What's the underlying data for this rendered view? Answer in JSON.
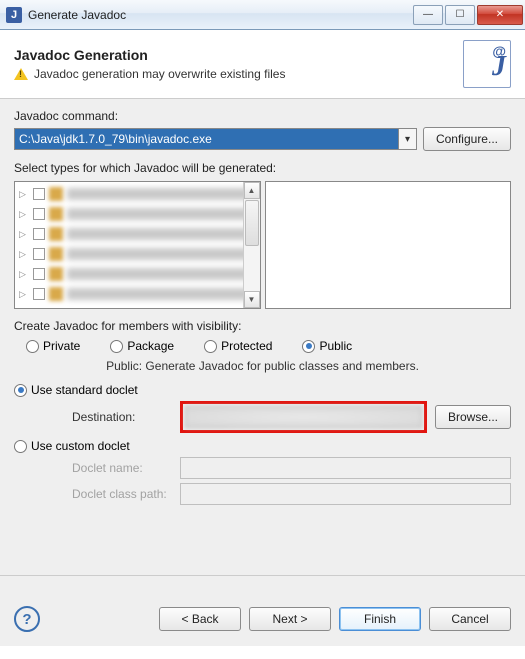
{
  "window": {
    "title": "Generate Javadoc"
  },
  "header": {
    "title": "Javadoc Generation",
    "subtitle": "Javadoc generation may overwrite existing files"
  },
  "command": {
    "label": "Javadoc command:",
    "value": "C:\\Java\\jdk1.7.0_79\\bin\\javadoc.exe",
    "configure_label": "Configure..."
  },
  "types": {
    "label": "Select types for which Javadoc will be generated:"
  },
  "visibility": {
    "label": "Create Javadoc for members with visibility:",
    "options": {
      "private": "Private",
      "package": "Package",
      "protected": "Protected",
      "public": "Public"
    },
    "selected": "public",
    "description": "Public: Generate Javadoc for public classes and members."
  },
  "doclet": {
    "standard_label": "Use standard doclet",
    "custom_label": "Use custom doclet",
    "selected": "standard",
    "destination_label": "Destination:",
    "browse_label": "Browse...",
    "doclet_name_label": "Doclet name:",
    "doclet_class_path_label": "Doclet class path:"
  },
  "buttons": {
    "back": "< Back",
    "next": "Next >",
    "finish": "Finish",
    "cancel": "Cancel"
  }
}
